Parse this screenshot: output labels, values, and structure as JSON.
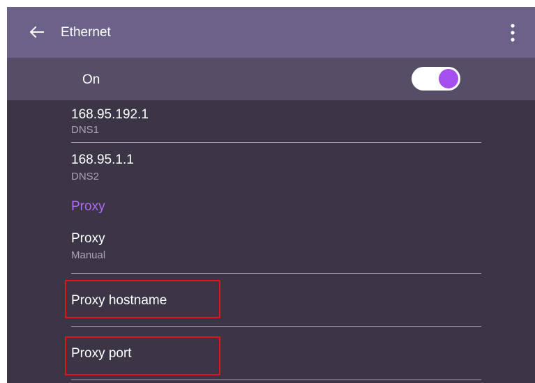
{
  "appbar": {
    "title": "Ethernet",
    "back_icon": "arrow-left-icon",
    "menu_icon": "more-vert-icon"
  },
  "toggle": {
    "label": "On",
    "state": "on",
    "accent_color": "#a64ff0"
  },
  "list": {
    "dns1": {
      "value": "168.95.192.1",
      "label": "DNS1"
    },
    "dns2": {
      "value": "168.95.1.1",
      "label": "DNS2"
    },
    "proxy_section": {
      "header": "Proxy"
    },
    "proxy": {
      "label": "Proxy",
      "value": "Manual"
    },
    "proxy_hostname": {
      "label": "Proxy hostname"
    },
    "proxy_port": {
      "label": "Proxy port"
    }
  },
  "colors": {
    "appbar_bg": "#6c6189",
    "toggle_bar_bg": "#564d67",
    "content_bg": "#3b3546",
    "section_header": "#b06af2",
    "highlight_box": "#e0141e"
  }
}
